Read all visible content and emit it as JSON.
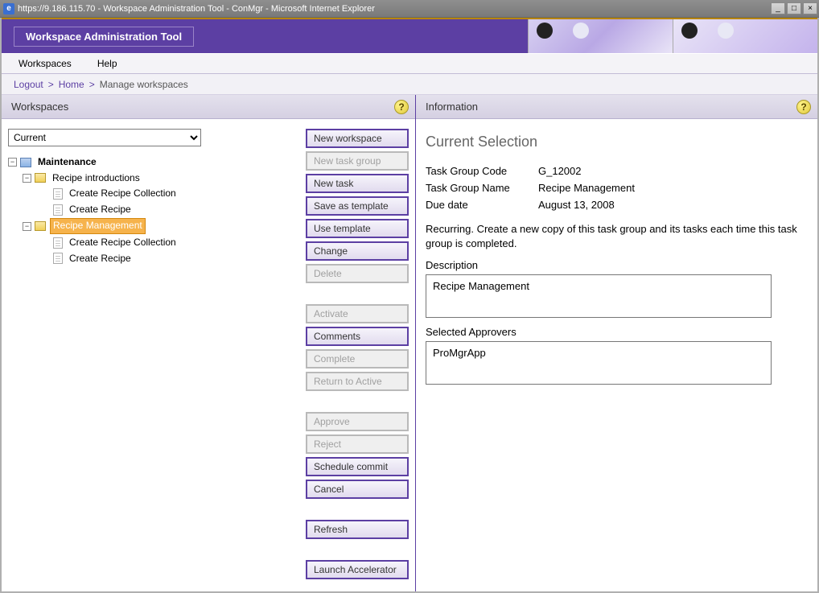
{
  "window": {
    "title": "https://9.186.115.70 - Workspace Administration Tool - ConMgr - Microsoft Internet Explorer"
  },
  "header": {
    "app_title": "Workspace Administration Tool"
  },
  "menubar": {
    "workspaces": "Workspaces",
    "help": "Help"
  },
  "breadcrumb": {
    "logout": "Logout",
    "home": "Home",
    "current": "Manage workspaces"
  },
  "left_panel": {
    "title": "Workspaces",
    "select_value": "Current",
    "tree": {
      "root": "Maintenance",
      "n1": "Recipe introductions",
      "n1a": "Create Recipe Collection",
      "n1b": "Create Recipe",
      "n2": "Recipe Management",
      "n2a": "Create Recipe Collection",
      "n2b": "Create Recipe"
    },
    "buttons": {
      "new_workspace": "New workspace",
      "new_task_group": "New task group",
      "new_task": "New task",
      "save_as_template": "Save as template",
      "use_template": "Use template",
      "change": "Change",
      "delete": "Delete",
      "activate": "Activate",
      "comments": "Comments",
      "complete": "Complete",
      "return_to_active": "Return to Active",
      "approve": "Approve",
      "reject": "Reject",
      "schedule_commit": "Schedule commit",
      "cancel": "Cancel",
      "refresh": "Refresh",
      "launch_accelerator": "Launch Accelerator"
    }
  },
  "right_panel": {
    "title": "Information",
    "section_title": "Current Selection",
    "fields": {
      "group_code_label": "Task Group Code",
      "group_code_value": "G_12002",
      "group_name_label": "Task Group Name",
      "group_name_value": "Recipe Management",
      "due_date_label": "Due date",
      "due_date_value": "August 13, 2008"
    },
    "recurring_text": "Recurring. Create a new copy of this task group and its tasks each time this task group is completed.",
    "description_label": "Description",
    "description_value": "Recipe Management",
    "approvers_label": "Selected Approvers",
    "approvers_value": "ProMgrApp"
  }
}
